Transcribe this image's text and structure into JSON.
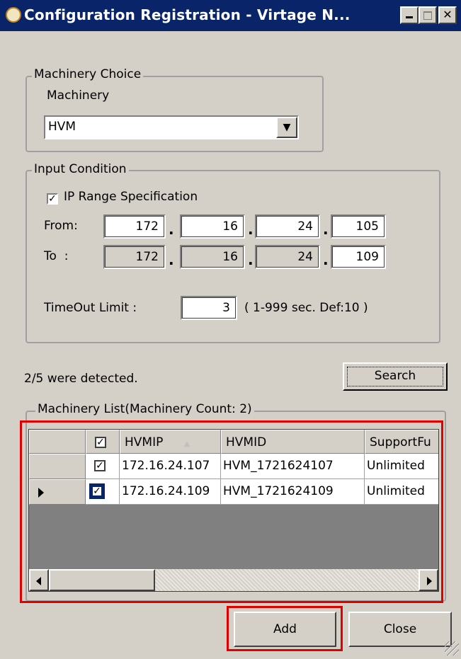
{
  "window": {
    "title": "Configuration Registration - Virtage N...",
    "title_icon": "app-icon"
  },
  "machinery_choice": {
    "group_label": "Machinery Choice",
    "field_label": "Machinery",
    "selected": "HVM"
  },
  "input_condition": {
    "group_label": "Input Condition",
    "ip_range_checked": true,
    "ip_range_label": "IP Range Specification",
    "from_label": "From:",
    "to_label": "To  :",
    "from": [
      "172",
      "16",
      "24",
      "105"
    ],
    "to": [
      "172",
      "16",
      "24",
      "109"
    ],
    "timeout_label": "TimeOut Limit :",
    "timeout_value": "3",
    "timeout_hint": "( 1-999 sec. Def:10 )"
  },
  "status": {
    "detected_text": "2/5 were detected."
  },
  "buttons": {
    "search": "Search",
    "add": "Add",
    "close": "Close"
  },
  "machinery_list": {
    "group_label": "Machinery List(Machinery Count: 2)",
    "columns": [
      "HVMIP",
      "HVMID",
      "SupportFu"
    ],
    "sort_indicator": "▲",
    "rows": [
      {
        "checked": true,
        "ip": "172.16.24.107",
        "id": "HVM_1721624107",
        "support": "Unlimited",
        "current": false
      },
      {
        "checked": true,
        "ip": "172.16.24.109",
        "id": "HVM_1721624109",
        "support": "Unlimited",
        "current": true
      }
    ]
  },
  "highlight_color": "#e00000",
  "titlebar_color": "#0a246a"
}
